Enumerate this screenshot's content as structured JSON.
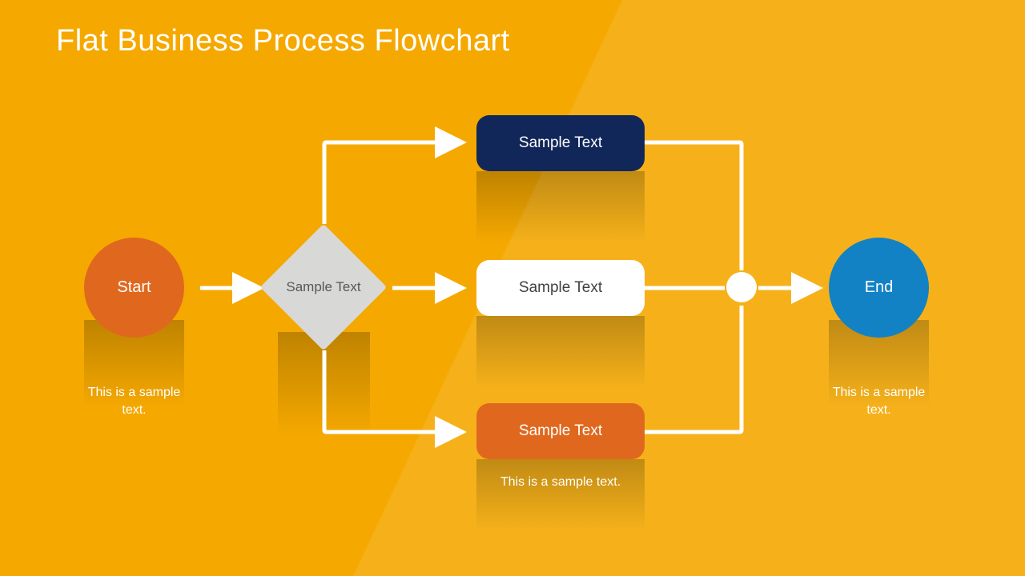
{
  "title": "Flat Business Process Flowchart",
  "start": {
    "label": "Start",
    "caption": "This is a sample text."
  },
  "decision": {
    "label": "Sample Text"
  },
  "processes": {
    "top": {
      "label": "Sample Text"
    },
    "middle": {
      "label": "Sample Text"
    },
    "bottom": {
      "label": "Sample Text",
      "caption": "This is a sample text."
    }
  },
  "end": {
    "label": "End",
    "caption": "This is a sample text."
  },
  "colors": {
    "background": "#f5a800",
    "start": "#e0681e",
    "decision": "#d8d8d7",
    "process_top": "#112759",
    "process_mid": "#ffffff",
    "process_bot": "#e0681e",
    "end": "#1382c5",
    "connector": "#ffffff"
  },
  "flow": {
    "type": "flowchart",
    "nodes": [
      {
        "id": "start",
        "kind": "terminator",
        "label_ref": "start.label"
      },
      {
        "id": "decision",
        "kind": "decision",
        "label_ref": "decision.label"
      },
      {
        "id": "p_top",
        "kind": "process",
        "label_ref": "processes.top.label"
      },
      {
        "id": "p_mid",
        "kind": "process",
        "label_ref": "processes.middle.label"
      },
      {
        "id": "p_bot",
        "kind": "process",
        "label_ref": "processes.bottom.label"
      },
      {
        "id": "join",
        "kind": "connector"
      },
      {
        "id": "end",
        "kind": "terminator",
        "label_ref": "end.label"
      }
    ],
    "edges": [
      [
        "start",
        "decision"
      ],
      [
        "decision",
        "p_top"
      ],
      [
        "decision",
        "p_mid"
      ],
      [
        "decision",
        "p_bot"
      ],
      [
        "p_top",
        "join"
      ],
      [
        "p_mid",
        "join"
      ],
      [
        "p_bot",
        "join"
      ],
      [
        "join",
        "end"
      ]
    ]
  }
}
